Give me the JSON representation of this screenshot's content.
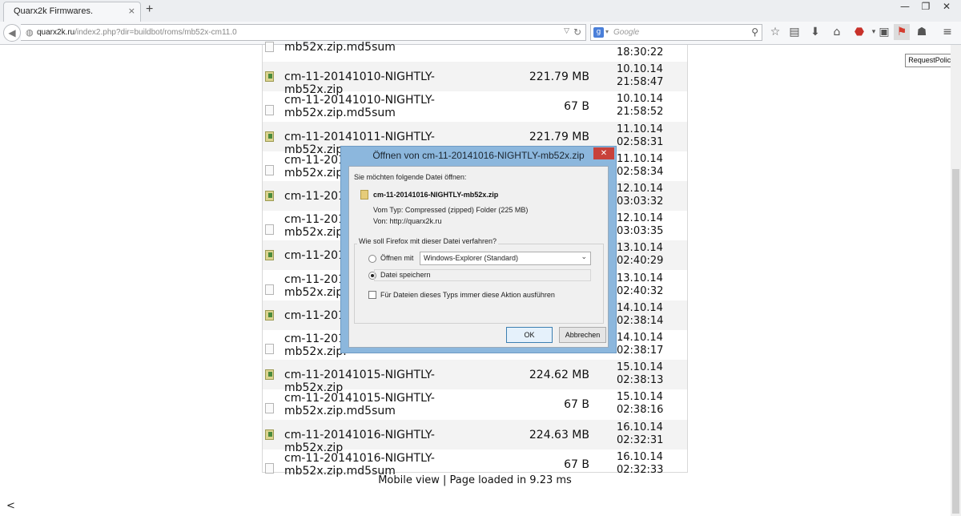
{
  "browser": {
    "tab_title": "Quarx2k Firmwares.",
    "tab_close": "×",
    "new_tab": "+",
    "url_host": "quarx2k.ru",
    "url_path": "/index2.php?dir=buildbot/roms/mb52x-cm11.0",
    "search_placeholder": "Google",
    "search_engine_letter": "g",
    "tooltip": "RequestPolicy",
    "window_controls": {
      "minimize": "—",
      "maximize": "❐",
      "close": "✕"
    }
  },
  "files": [
    {
      "name_line1": "mb52x.zip.md5sum",
      "name_line2": "",
      "size": "",
      "date": "",
      "time": "18:30:22",
      "icon": "doc-icon"
    },
    {
      "name_line1": "cm-11-20141010-NIGHTLY-mb52x.zip",
      "name_line2": "",
      "size": "221.79 MB",
      "date": "10.10.14",
      "time": "21:58:47",
      "icon": "zip-icon"
    },
    {
      "name_line1": "cm-11-20141010-NIGHTLY-",
      "name_line2": "mb52x.zip.md5sum",
      "size": "67 B",
      "date": "10.10.14",
      "time": "21:58:52",
      "icon": "doc-icon"
    },
    {
      "name_line1": "cm-11-20141011-NIGHTLY-mb52x.zip",
      "name_line2": "",
      "size": "221.79 MB",
      "date": "11.10.14",
      "time": "02:58:31",
      "icon": "zip-icon"
    },
    {
      "name_line1": "cm-11-201",
      "name_line2": "mb52x.zip.",
      "size": "",
      "date": "11.10.14",
      "time": "02:58:34",
      "icon": "doc-icon"
    },
    {
      "name_line1": "cm-11-201",
      "name_line2": "",
      "size": "",
      "date": "12.10.14",
      "time": "03:03:32",
      "icon": "zip-icon"
    },
    {
      "name_line1": "cm-11-201",
      "name_line2": "mb52x.zip.",
      "size": "",
      "date": "12.10.14",
      "time": "03:03:35",
      "icon": "doc-icon"
    },
    {
      "name_line1": "cm-11-201",
      "name_line2": "",
      "size": "",
      "date": "13.10.14",
      "time": "02:40:29",
      "icon": "zip-icon"
    },
    {
      "name_line1": "cm-11-201",
      "name_line2": "mb52x.zip.",
      "size": "",
      "date": "13.10.14",
      "time": "02:40:32",
      "icon": "doc-icon"
    },
    {
      "name_line1": "cm-11-201",
      "name_line2": "",
      "size": "",
      "date": "14.10.14",
      "time": "02:38:14",
      "icon": "zip-icon"
    },
    {
      "name_line1": "cm-11-201",
      "name_line2": "mb52x.zip.",
      "size": "",
      "date": "14.10.14",
      "time": "02:38:17",
      "icon": "doc-icon"
    },
    {
      "name_line1": "cm-11-20141015-NIGHTLY-mb52x.zip",
      "name_line2": "",
      "size": "224.62 MB",
      "date": "15.10.14",
      "time": "02:38:13",
      "icon": "zip-icon"
    },
    {
      "name_line1": "cm-11-20141015-NIGHTLY-",
      "name_line2": "mb52x.zip.md5sum",
      "size": "67 B",
      "date": "15.10.14",
      "time": "02:38:16",
      "icon": "doc-icon"
    },
    {
      "name_line1": "cm-11-20141016-NIGHTLY-mb52x.zip",
      "name_line2": "",
      "size": "224.63 MB",
      "date": "16.10.14",
      "time": "02:32:31",
      "icon": "zip-icon"
    },
    {
      "name_line1": "cm-11-20141016-NIGHTLY-",
      "name_line2": "mb52x.zip.md5sum",
      "size": "67 B",
      "date": "16.10.14",
      "time": "02:32:33",
      "icon": "doc-icon"
    }
  ],
  "footer": "Mobile view | Page loaded in 9.23 ms",
  "page_left_arrow": "<",
  "dialog": {
    "title": "Öffnen von cm-11-20141016-NIGHTLY-mb52x.zip",
    "close": "✕",
    "intro": "Sie möchten folgende Datei öffnen:",
    "filename": "cm-11-20141016-NIGHTLY-mb52x.zip",
    "type_line": "Vom Typ:  Compressed (zipped) Folder (225 MB)",
    "from_line": "Von:  http://quarx2k.ru",
    "question": "Wie soll Firefox mit dieser Datei verfahren?",
    "open_with_label": "Öffnen mit",
    "open_with_value": "Windows-Explorer (Standard)",
    "save_label": "Datei speichern",
    "always_label": "Für Dateien dieses Typs immer diese Aktion ausführen",
    "ok_label": "OK",
    "cancel_label": "Abbrechen"
  }
}
